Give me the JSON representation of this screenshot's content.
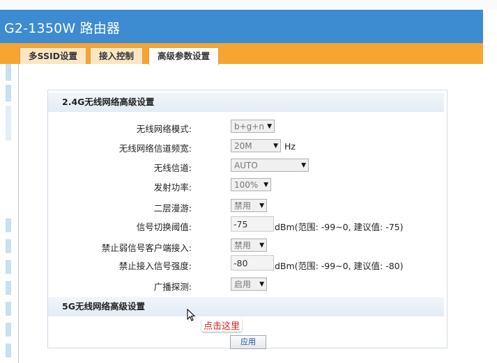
{
  "header": {
    "title": "G2-1350W 路由器"
  },
  "tabs": [
    {
      "label": "多SSID设置"
    },
    {
      "label": "接入控制"
    },
    {
      "label": "高级参数设置"
    }
  ],
  "section_24g": {
    "title": "2.4G无线网络高级设置",
    "rows": [
      {
        "label": "无线网络模式:",
        "value": "b+g+n",
        "suffix": ""
      },
      {
        "label": "无线网络信道频宽:",
        "value": "20M",
        "suffix": "Hz"
      },
      {
        "label": "无线信道:",
        "value": "AUTO",
        "suffix": ""
      },
      {
        "label": "发射功率:",
        "value": "100%",
        "suffix": ""
      },
      {
        "label": "二层漫游:",
        "value": "禁用",
        "suffix": ""
      },
      {
        "label": "信号切换阈值:",
        "value": "-75",
        "suffix": "dBm(范围: -99~0, 建议值: -75)"
      },
      {
        "label": "禁止弱信号客户端接入:",
        "value": "禁用",
        "suffix": ""
      },
      {
        "label": "禁止接入信号强度:",
        "value": "-80",
        "suffix": "dBm(范围: -99~0, 建议值: -80)"
      },
      {
        "label": "广播探测:",
        "value": "启用",
        "suffix": ""
      }
    ]
  },
  "section_5g": {
    "title": "5G无线网络高级设置"
  },
  "apply_button": {
    "label": "应用"
  },
  "annotation": {
    "text": "点击这里"
  },
  "colors": {
    "header": "#3d8bd0",
    "tabbar": "#f6a531",
    "annotation": "#e02020"
  }
}
